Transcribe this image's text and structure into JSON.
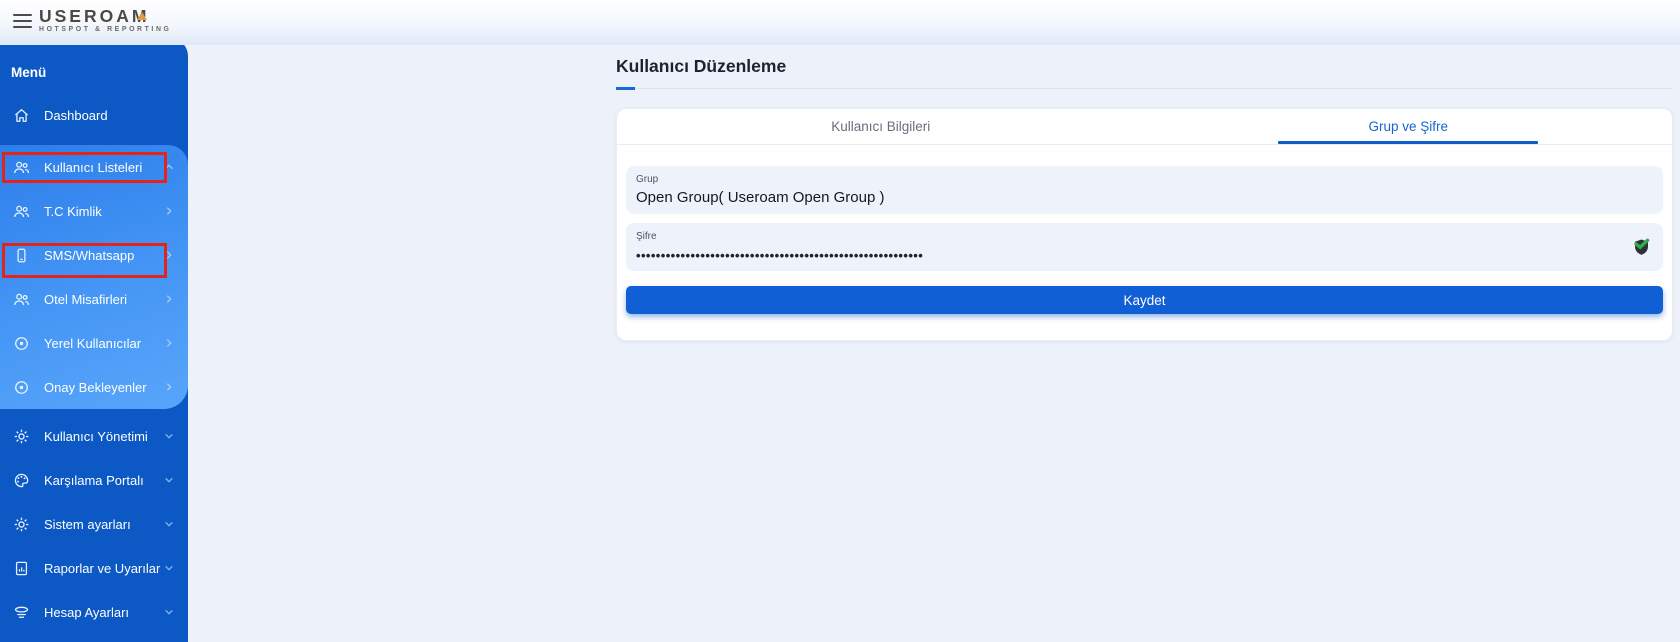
{
  "brand": {
    "name": "USEROAM",
    "tagline": "HOTSPOT & REPORTING"
  },
  "sidebar": {
    "heading": "Menü",
    "items": [
      {
        "label": "Dashboard",
        "icon": "home-icon",
        "chevron": "none"
      },
      {
        "label": "Kullanıcı Listeleri",
        "icon": "users-icon",
        "chevron": "up",
        "highlighted": true,
        "expanded": true
      },
      {
        "label": "T.C Kimlik",
        "icon": "users-icon",
        "chevron": "right"
      },
      {
        "label": "SMS/Whatsapp",
        "icon": "phone-icon",
        "chevron": "right",
        "highlighted": true
      },
      {
        "label": "Otel Misafirleri",
        "icon": "users-icon",
        "chevron": "right"
      },
      {
        "label": "Yerel Kullanıcılar",
        "icon": "target-icon",
        "chevron": "right"
      },
      {
        "label": "Onay Bekleyenler",
        "icon": "target-icon",
        "chevron": "right"
      },
      {
        "label": "Kullanıcı Yönetimi",
        "icon": "gear-icon",
        "chevron": "down"
      },
      {
        "label": "Karşılama Portalı",
        "icon": "palette-icon",
        "chevron": "down"
      },
      {
        "label": "Sistem ayarları",
        "icon": "gear-icon",
        "chevron": "down"
      },
      {
        "label": "Raporlar ve Uyarılar",
        "icon": "report-icon",
        "chevron": "down"
      },
      {
        "label": "Hesap Ayarları",
        "icon": "account-icon",
        "chevron": "down"
      }
    ]
  },
  "main": {
    "title": "Kullanıcı Düzenleme",
    "tabs": [
      {
        "label": "Kullanıcı Bilgileri",
        "active": false
      },
      {
        "label": "Grup ve Şifre",
        "active": true
      }
    ],
    "form": {
      "group": {
        "label": "Grup",
        "value": "Open Group( Useroam Open Group )"
      },
      "password": {
        "label": "Şifre",
        "masked_value": "••••••••••••••••••••••••••••••••••••••••••••••••••••••••••",
        "strength_icon": "shield-check-icon"
      },
      "save_label": "Kaydet"
    }
  },
  "annotations": {
    "highlight_color": "#e2241b",
    "highlighted_items": [
      "Kullanıcı Listeleri",
      "SMS/Whatsapp"
    ]
  },
  "colors": {
    "sidebar_blue": "#0c59c5",
    "sidebar_expanded_gradient": [
      "#2d7eea",
      "#58a5fa"
    ],
    "accent_blue": "#1565d2",
    "save_button_blue": "#115fd4",
    "field_background": "#eef2fa",
    "shield_green": "#2fae47",
    "logo_accent_orange": "#dd9f3e"
  }
}
